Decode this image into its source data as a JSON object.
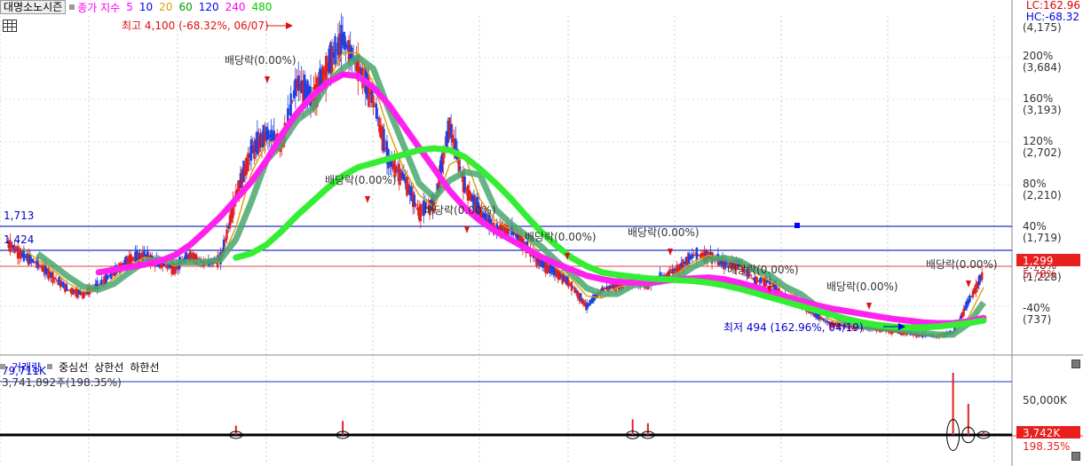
{
  "toolbar": {
    "stock_name": "대명소노시즌",
    "indicator": "종가 지수",
    "ma_periods": [
      {
        "label": "5",
        "color": "#ff00ff"
      },
      {
        "label": "10",
        "color": "#0000ff"
      },
      {
        "label": "20",
        "color": "#e0a000"
      },
      {
        "label": "60",
        "color": "#009900"
      },
      {
        "label": "120",
        "color": "#0000ff"
      },
      {
        "label": "240",
        "color": "#ff00ff"
      },
      {
        "label": "480",
        "color": "#00cc00"
      }
    ]
  },
  "right_top": {
    "lc": "LC:162.96",
    "hc": "HC:-68.32"
  },
  "price_axis": [
    {
      "pct": "",
      "price": "(4,175)"
    },
    {
      "pct": "200%",
      "price": "(3,684)"
    },
    {
      "pct": "160%",
      "price": "(3,193)"
    },
    {
      "pct": "120%",
      "price": "(2,702)"
    },
    {
      "pct": "80%",
      "price": "(2,210)"
    },
    {
      "pct": "40%",
      "price": "(1,719)"
    },
    {
      "pct": "5.78%",
      "price": "(1,228)"
    },
    {
      "pct": "-40%",
      "price": "(737)"
    }
  ],
  "current_price": {
    "value": "1,299",
    "pct": "5.78%"
  },
  "left_labels": {
    "upper": "1,713",
    "lower": "1,424"
  },
  "annotations": {
    "high": "최고 4,100 (-68.32%, 06/07)",
    "low": "최저 494 (162.96%, 04/19)",
    "dividends": [
      "배당락(0.00%)",
      "배당락(0.00%)",
      "배당락(0.00%)",
      "배당락(0.00%)",
      "배당락(0.00%)",
      "배당락(0.00%)",
      "배당락(0.00%)",
      "배당락(0.00%)"
    ]
  },
  "volume": {
    "header_items": [
      "거래량",
      "중심선",
      "상한선",
      "하한선"
    ],
    "left_value": "79,711K",
    "detail": "3,741,892주(198.35%)",
    "axis_label": "50,000K",
    "current": "3,742K",
    "current_pct": "198.35%"
  },
  "chart_data": {
    "type": "line",
    "title": "대명소노시즌",
    "price_range": [
      494,
      4175
    ],
    "highest": {
      "price": 4100,
      "pct_from_current": -68.32,
      "date": "06/07"
    },
    "lowest": {
      "price": 494,
      "pct_from_current": 162.96,
      "date": "04/19"
    },
    "current_price": 1299,
    "horizontal_lines": [
      1713,
      1424,
      1299
    ],
    "series": [
      {
        "name": "종가",
        "values": [
          1650,
          1500,
          1400,
          1250,
          1100,
          1050,
          1150,
          1300,
          1450,
          1500,
          1400,
          1350,
          1500,
          1400,
          1450,
          2200,
          2700,
          2900,
          2800,
          3500,
          3300,
          3700,
          4000,
          3700,
          3300,
          2600,
          2400,
          2000,
          2100,
          3000,
          2300,
          2000,
          1800,
          1800,
          1600,
          1400,
          1300,
          1150,
          900,
          1100,
          1150,
          1200,
          1150,
          1250,
          1350,
          1500,
          1500,
          1400,
          1400,
          1200,
          1200,
          1000,
          950,
          800,
          700,
          680,
          650,
          650,
          620,
          600,
          570,
          560,
          600,
          950,
          1300
        ]
      },
      {
        "name": "240",
        "values": [
          null,
          null,
          null,
          null,
          null,
          null,
          1300,
          1330,
          1360,
          1390,
          1430,
          1500,
          1620,
          1780,
          1950,
          2150,
          2350,
          2600,
          2900,
          3150,
          3350,
          3500,
          3600,
          3580,
          3450,
          3250,
          3000,
          2750,
          2500,
          2250,
          2050,
          1900,
          1780,
          1680,
          1580,
          1480,
          1400,
          1330,
          1260,
          1220,
          1190,
          1180,
          1180,
          1200,
          1220,
          1230,
          1240,
          1220,
          1180,
          1130,
          1080,
          1020,
          970,
          920,
          880,
          850,
          820,
          790,
          760,
          740,
          720,
          710,
          710,
          730,
          770
        ]
      },
      {
        "name": "480",
        "values": [
          null,
          null,
          null,
          null,
          null,
          null,
          null,
          null,
          null,
          null,
          null,
          null,
          null,
          null,
          null,
          1470,
          1520,
          1620,
          1780,
          1960,
          2120,
          2280,
          2420,
          2520,
          2570,
          2620,
          2670,
          2720,
          2740,
          2720,
          2640,
          2500,
          2340,
          2160,
          1960,
          1770,
          1610,
          1470,
          1370,
          1300,
          1270,
          1250,
          1230,
          1220,
          1210,
          1200,
          1180,
          1150,
          1110,
          1060,
          1010,
          960,
          910,
          860,
          810,
          760,
          720,
          690,
          670,
          660,
          660,
          670,
          690,
          710,
          740
        ]
      }
    ],
    "volume_spikes_k": [
      0,
      0,
      0,
      0,
      0,
      0,
      0,
      0,
      0,
      0,
      0,
      0,
      0,
      0,
      0,
      12000,
      0,
      0,
      0,
      0,
      0,
      0,
      18000,
      0,
      0,
      0,
      0,
      0,
      0,
      0,
      0,
      0,
      0,
      0,
      0,
      0,
      0,
      0,
      0,
      0,
      0,
      20000,
      15000,
      0,
      0,
      0,
      0,
      0,
      0,
      0,
      0,
      0,
      0,
      0,
      0,
      0,
      0,
      0,
      0,
      0,
      0,
      0,
      79711,
      40000,
      3742
    ],
    "volume_axis": {
      "label": "50,000K",
      "max": 79711
    }
  }
}
